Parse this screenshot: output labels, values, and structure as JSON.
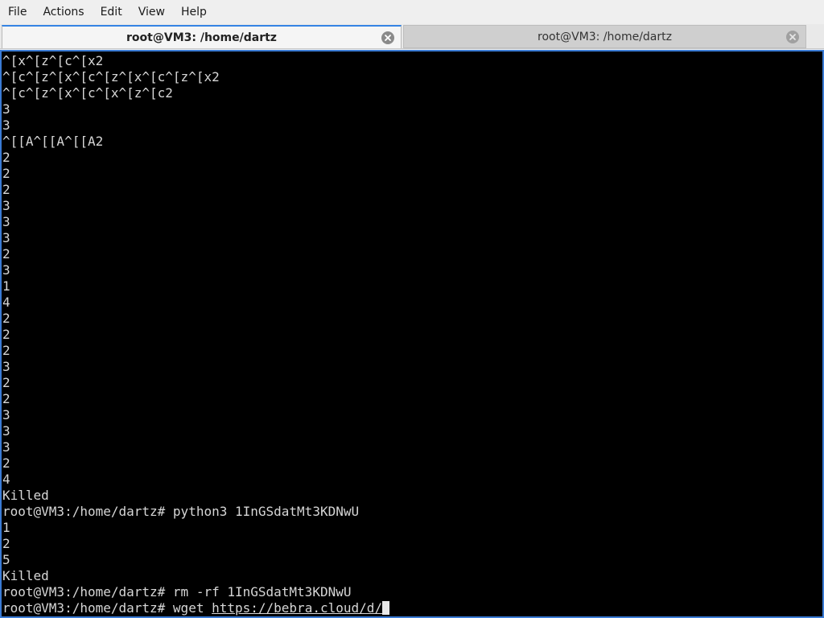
{
  "menubar": {
    "items": [
      "File",
      "Actions",
      "Edit",
      "View",
      "Help"
    ]
  },
  "tabs": [
    {
      "label": "root@VM3: /home/dartz",
      "active": true
    },
    {
      "label": "root@VM3: /home/dartz",
      "active": false
    }
  ],
  "terminal": {
    "lines": [
      "^[x^[z^[c^[x2",
      "^[c^[z^[x^[c^[z^[x^[c^[z^[x2",
      "^[c^[z^[x^[c^[x^[z^[c2",
      "3",
      "3",
      "^[[A^[[A^[[A2",
      "2",
      "2",
      "2",
      "3",
      "3",
      "3",
      "2",
      "3",
      "1",
      "4",
      "2",
      "2",
      "2",
      "3",
      "2",
      "2",
      "3",
      "3",
      "3",
      "2",
      "4",
      "Killed",
      "root@VM3:/home/dartz# python3 1InGSdatMt3KDNwU",
      "1",
      "2",
      "5",
      "Killed",
      "root@VM3:/home/dartz# rm -rf 1InGSdatMt3KDNwU"
    ],
    "prompt": "root@VM3:/home/dartz# ",
    "command": "wget ",
    "url": "https://bebra.cloud/d/"
  }
}
